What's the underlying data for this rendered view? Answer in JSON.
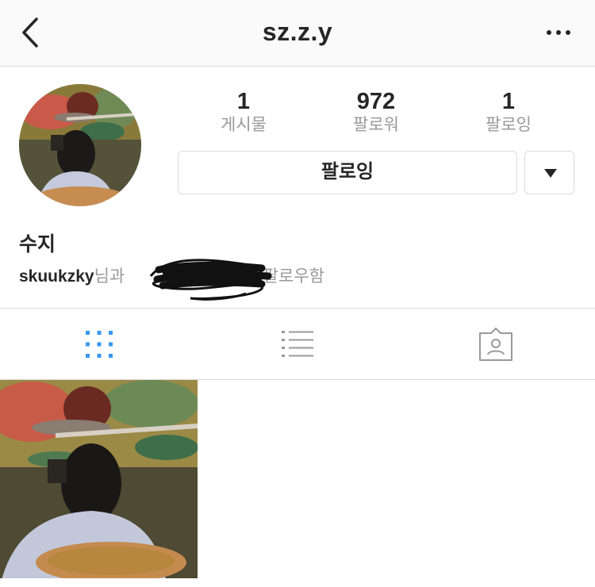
{
  "header": {
    "title": "sz.z.y",
    "back_icon": "chevron-left-icon",
    "more_icon": "more-horizontal-icon"
  },
  "profile": {
    "avatar": "profile-photo",
    "display_name": "수지",
    "stats": [
      {
        "value": "1",
        "label": "게시물"
      },
      {
        "value": "972",
        "label": "팔로워"
      },
      {
        "value": "1",
        "label": "팔로잉"
      }
    ],
    "follow_button_label": "팔로잉",
    "dropdown_icon": "caret-down-icon",
    "followed_by": {
      "username": "skuukzky",
      "text_before": "님과",
      "text_after": "님이 팔로우함"
    }
  },
  "tabs": [
    {
      "name": "grid-view",
      "icon": "grid-icon",
      "active": true
    },
    {
      "name": "list-view",
      "icon": "list-icon",
      "active": false
    },
    {
      "name": "tagged",
      "icon": "tagged-person-icon",
      "active": false
    }
  ],
  "colors": {
    "accent": "#3897f0",
    "text": "#262626",
    "muted": "#999999",
    "border": "#dbdbdb",
    "topbar": "#fafafa"
  }
}
